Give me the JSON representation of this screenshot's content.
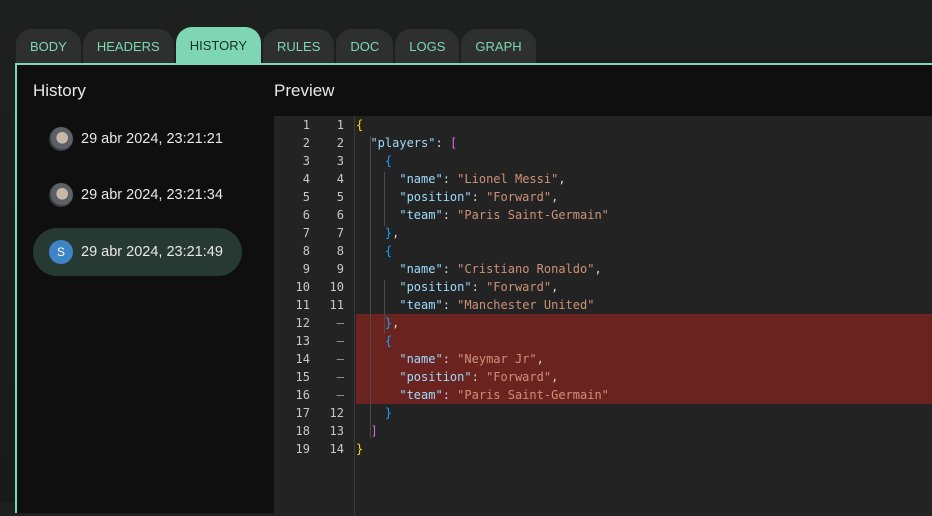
{
  "tabs": [
    {
      "label": "BODY",
      "active": false
    },
    {
      "label": "HEADERS",
      "active": false
    },
    {
      "label": "HISTORY",
      "active": true
    },
    {
      "label": "RULES",
      "active": false
    },
    {
      "label": "DOC",
      "active": false
    },
    {
      "label": "LOGS",
      "active": false
    },
    {
      "label": "GRAPH",
      "active": false
    }
  ],
  "history": {
    "title": "History",
    "items": [
      {
        "timestamp": "29 abr 2024, 23:21:21",
        "avatar": "photo",
        "selected": false
      },
      {
        "timestamp": "29 abr 2024, 23:21:34",
        "avatar": "photo",
        "selected": false
      },
      {
        "timestamp": "29 abr 2024, 23:21:49",
        "avatar": "letter",
        "avatar_letter": "S",
        "selected": true
      }
    ]
  },
  "preview": {
    "title": "Preview",
    "lines": [
      {
        "a": "1",
        "b": "1",
        "removed": false,
        "tokens": [
          [
            "b1",
            "{"
          ]
        ]
      },
      {
        "a": "2",
        "b": "2",
        "removed": false,
        "tokens": [
          [
            "p",
            "  "
          ],
          [
            "k",
            "\"players\""
          ],
          [
            "p",
            ": "
          ],
          [
            "b2",
            "["
          ]
        ]
      },
      {
        "a": "3",
        "b": "3",
        "removed": false,
        "tokens": [
          [
            "p",
            "    "
          ],
          [
            "b3",
            "{"
          ]
        ]
      },
      {
        "a": "4",
        "b": "4",
        "removed": false,
        "tokens": [
          [
            "p",
            "      "
          ],
          [
            "k",
            "\"name\""
          ],
          [
            "p",
            ": "
          ],
          [
            "s",
            "\"Lionel Messi\""
          ],
          [
            "p",
            ","
          ]
        ]
      },
      {
        "a": "5",
        "b": "5",
        "removed": false,
        "tokens": [
          [
            "p",
            "      "
          ],
          [
            "k",
            "\"position\""
          ],
          [
            "p",
            ": "
          ],
          [
            "s",
            "\"Forward\""
          ],
          [
            "p",
            ","
          ]
        ]
      },
      {
        "a": "6",
        "b": "6",
        "removed": false,
        "tokens": [
          [
            "p",
            "      "
          ],
          [
            "k",
            "\"team\""
          ],
          [
            "p",
            ": "
          ],
          [
            "s",
            "\"Paris Saint-Germain\""
          ]
        ]
      },
      {
        "a": "7",
        "b": "7",
        "removed": false,
        "tokens": [
          [
            "p",
            "    "
          ],
          [
            "b3",
            "}"
          ],
          [
            "p",
            ","
          ]
        ]
      },
      {
        "a": "8",
        "b": "8",
        "removed": false,
        "tokens": [
          [
            "p",
            "    "
          ],
          [
            "b3",
            "{"
          ]
        ]
      },
      {
        "a": "9",
        "b": "9",
        "removed": false,
        "tokens": [
          [
            "p",
            "      "
          ],
          [
            "k",
            "\"name\""
          ],
          [
            "p",
            ": "
          ],
          [
            "s",
            "\"Cristiano Ronaldo\""
          ],
          [
            "p",
            ","
          ]
        ]
      },
      {
        "a": "10",
        "b": "10",
        "removed": false,
        "tokens": [
          [
            "p",
            "      "
          ],
          [
            "k",
            "\"position\""
          ],
          [
            "p",
            ": "
          ],
          [
            "s",
            "\"Forward\""
          ],
          [
            "p",
            ","
          ]
        ]
      },
      {
        "a": "11",
        "b": "11",
        "removed": false,
        "tokens": [
          [
            "p",
            "      "
          ],
          [
            "k",
            "\"team\""
          ],
          [
            "p",
            ": "
          ],
          [
            "s",
            "\"Manchester United\""
          ]
        ]
      },
      {
        "a": "12",
        "b": "—",
        "removed": true,
        "tokens": [
          [
            "p",
            "    "
          ],
          [
            "b3",
            "}"
          ],
          [
            "p",
            ","
          ]
        ]
      },
      {
        "a": "13",
        "b": "—",
        "removed": true,
        "tokens": [
          [
            "p",
            "    "
          ],
          [
            "b3",
            "{"
          ]
        ]
      },
      {
        "a": "14",
        "b": "—",
        "removed": true,
        "tokens": [
          [
            "p",
            "      "
          ],
          [
            "k",
            "\"name\""
          ],
          [
            "p",
            ": "
          ],
          [
            "s",
            "\"Neymar Jr\""
          ],
          [
            "p",
            ","
          ]
        ]
      },
      {
        "a": "15",
        "b": "—",
        "removed": true,
        "tokens": [
          [
            "p",
            "      "
          ],
          [
            "k",
            "\"position\""
          ],
          [
            "p",
            ": "
          ],
          [
            "s",
            "\"Forward\""
          ],
          [
            "p",
            ","
          ]
        ]
      },
      {
        "a": "16",
        "b": "—",
        "removed": true,
        "tokens": [
          [
            "p",
            "      "
          ],
          [
            "k",
            "\"team\""
          ],
          [
            "p",
            ": "
          ],
          [
            "s",
            "\"Paris Saint-Germain\""
          ]
        ]
      },
      {
        "a": "17",
        "b": "12",
        "removed": false,
        "tokens": [
          [
            "p",
            "    "
          ],
          [
            "b3",
            "}"
          ]
        ]
      },
      {
        "a": "18",
        "b": "13",
        "removed": false,
        "tokens": [
          [
            "p",
            "  "
          ],
          [
            "b2",
            "]"
          ]
        ]
      },
      {
        "a": "19",
        "b": "14",
        "removed": false,
        "tokens": [
          [
            "b1",
            "}"
          ]
        ]
      }
    ]
  }
}
